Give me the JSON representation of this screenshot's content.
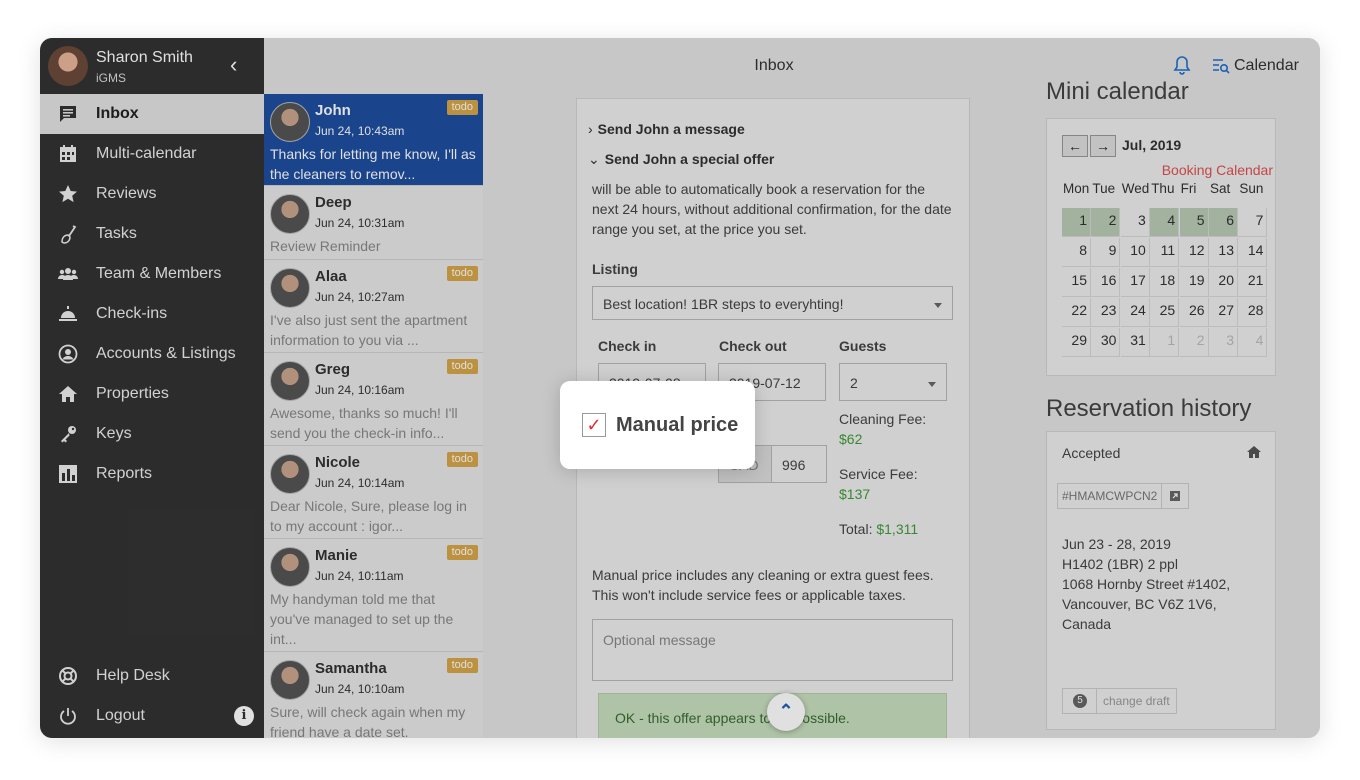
{
  "profile": {
    "name": "Sharon Smith",
    "org": "iGMS",
    "collapse_icon": "chevron-left-icon"
  },
  "nav": {
    "items": [
      {
        "label": "Inbox",
        "icon": "message-icon",
        "active": true
      },
      {
        "label": "Multi-calendar",
        "icon": "calendar-icon"
      },
      {
        "label": "Reviews",
        "icon": "star-icon"
      },
      {
        "label": "Tasks",
        "icon": "broom-icon"
      },
      {
        "label": "Team & Members",
        "icon": "team-icon"
      },
      {
        "label": "Check-ins",
        "icon": "bell-desk-icon"
      },
      {
        "label": "Accounts & Listings",
        "icon": "account-icon"
      },
      {
        "label": "Properties",
        "icon": "home-icon"
      },
      {
        "label": "Keys",
        "icon": "key-icon"
      },
      {
        "label": "Reports",
        "icon": "reports-icon"
      }
    ],
    "bottom": [
      {
        "label": "Help Desk",
        "icon": "lifebuoy-icon"
      },
      {
        "label": "Logout",
        "icon": "power-icon"
      }
    ],
    "info": "i"
  },
  "header": {
    "title": "Inbox",
    "calendar_label": "Calendar"
  },
  "conversations": [
    {
      "name": "John",
      "date": "Jun 24, 10:43am",
      "message": "Thanks for letting me know, I'll as the cleaners to remov...",
      "todo": "todo",
      "active": true
    },
    {
      "name": "Deep",
      "date": "Jun 24, 10:31am",
      "message": "Review Reminder",
      "todo": ""
    },
    {
      "name": "Alaa",
      "date": "Jun 24, 10:27am",
      "message": "I've also just sent the apartment information to you via ...",
      "todo": "todo"
    },
    {
      "name": "Greg",
      "date": "Jun 24, 10:16am",
      "message": "Awesome, thanks so much! I'll send you the check-in info...",
      "todo": "todo"
    },
    {
      "name": "Nicole",
      "date": "Jun 24, 10:14am",
      "message": "Dear Nicole, Sure, please log in to my account : igor...",
      "todo": "todo"
    },
    {
      "name": "Manie",
      "date": "Jun 24, 10:11am",
      "message": "My handyman told me that you've managed to set up the int...",
      "todo": "todo"
    },
    {
      "name": "Samantha",
      "date": "Jun 24, 10:10am",
      "message": "Sure, will check again when my friend have a date set.",
      "todo": "todo"
    }
  ],
  "offer": {
    "send_message": "Send John a message",
    "send_offer": "Send John a special offer",
    "description": "will be able to automatically book a reservation for the next 24 hours, without additional confirmation, for the date range you set, at the price you set.",
    "listing_label": "Listing",
    "listing_value": "Best location! 1BR steps to everyhting!",
    "checkin_label": "Check in",
    "checkin_value": "2019-07-08",
    "checkout_label": "Check out",
    "checkout_value": "2019-07-12",
    "guests_label": "Guests",
    "guests_value": "2",
    "currency_value": "CAD",
    "price_value": "996",
    "cleaning_fee_label": "Cleaning Fee:",
    "cleaning_fee_value": "$62",
    "service_fee_label": "Service Fee:",
    "service_fee_value": "$137",
    "total_label": "Total:",
    "total_value": "$1,311",
    "note": "Manual price includes any cleaning or extra guest fees. This won't include service fees or applicable taxes.",
    "message_placeholder": "Optional message",
    "ok_text": "OK - this offer appears to be possible.",
    "scroll_up": "^"
  },
  "mini_calendar": {
    "title": "Mini calendar",
    "month": "Jul, 2019",
    "prev": "←",
    "next": "→",
    "booking_link": "Booking Calendar",
    "weekdays": [
      "Mon",
      "Tue",
      "Wed",
      "Thu",
      "Fri",
      "Sat",
      "Sun"
    ],
    "days": [
      "1",
      "2",
      "3",
      "4",
      "5",
      "6",
      "7",
      "8",
      "9",
      "10",
      "11",
      "12",
      "13",
      "14",
      "15",
      "16",
      "17",
      "18",
      "19",
      "20",
      "21",
      "22",
      "23",
      "24",
      "25",
      "26",
      "27",
      "28",
      "29",
      "30",
      "31",
      "1",
      "2",
      "3",
      "4"
    ],
    "booked_days": [
      0,
      1,
      3,
      4,
      5
    ],
    "dim_days": [
      31,
      32,
      33,
      34
    ]
  },
  "reservation": {
    "title": "Reservation history",
    "status": "Accepted",
    "code": "#HMAMCWPCN2",
    "dates": "Jun 23 - 28, 2019",
    "unit": "H1402 (1BR) 2 ppl",
    "address1": "1068 Hornby Street #1402,",
    "address2": "Vancouver, BC V6Z 1V6,",
    "address3": "Canada",
    "draft_count": "5",
    "draft_label": "change draft"
  },
  "popup": {
    "label": "Manual price",
    "checked": true,
    "checkmark": "✓"
  },
  "colors": {
    "sidebar": "#333333",
    "active_conversation": "#1e4ea0",
    "todo": "#d6a548",
    "booked": "#b9cbb4",
    "fee": "#3f9b3a",
    "link_red": "#e05050"
  }
}
